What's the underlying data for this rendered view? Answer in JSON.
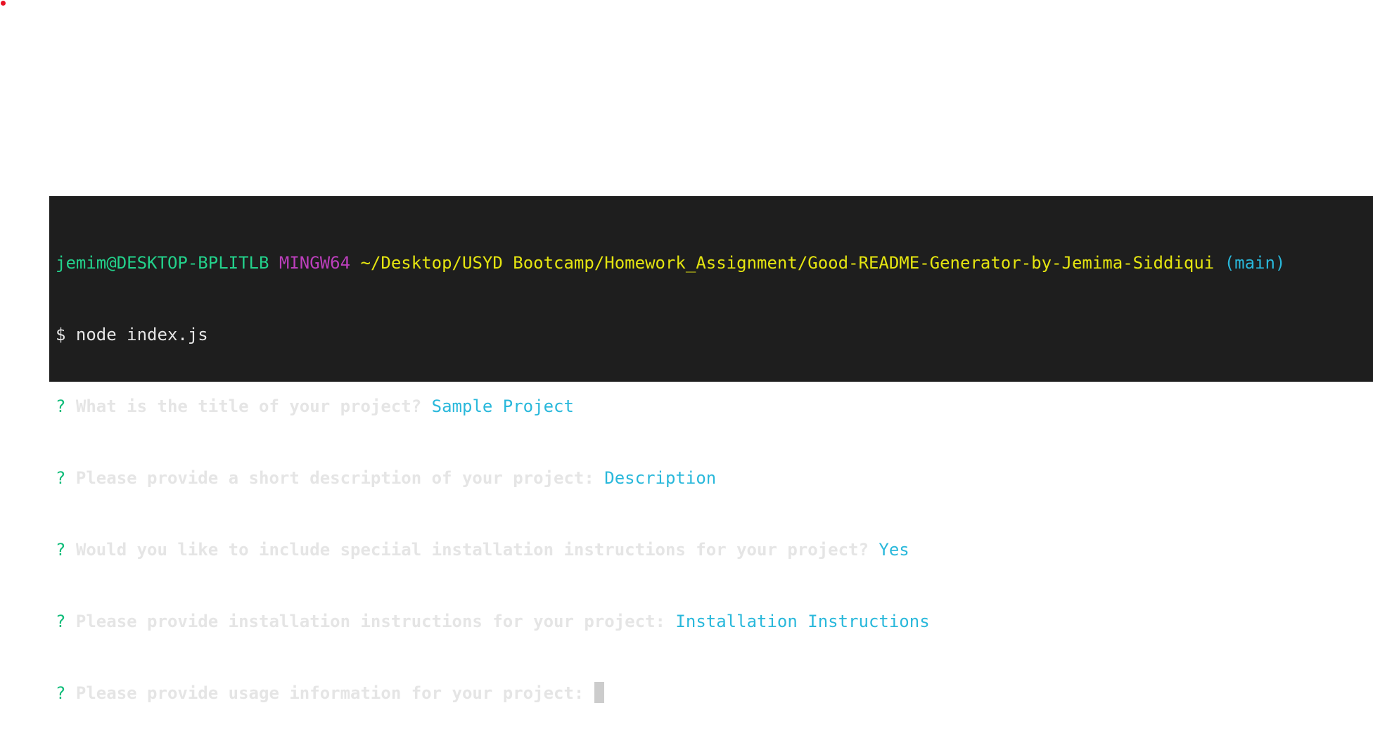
{
  "prompt": {
    "user_host": "jemim@DESKTOP-BPLITLB",
    "shell": "MINGW64",
    "path": "~/Desktop/USYD Bootcamp/Homework_Assignment/Good-README-Generator-by-Jemima-Siddiqui",
    "branch": "(main)"
  },
  "command": {
    "symbol": "$",
    "text": "node index.js"
  },
  "questions": [
    {
      "marker": "?",
      "question": "What is the title of your project?",
      "answer": "Sample Project"
    },
    {
      "marker": "?",
      "question": "Please provide a short description of your project:",
      "answer": "Description"
    },
    {
      "marker": "?",
      "question": "Would you like to include speciial installation instructions for your project?",
      "answer": "Yes"
    },
    {
      "marker": "?",
      "question": "Please provide installation instructions for your project:",
      "answer": "Installation Instructions"
    },
    {
      "marker": "?",
      "question": "Please provide usage information for your project:",
      "answer": ""
    }
  ],
  "colors": {
    "background": "#1e1e1e",
    "user_host": "#23d18b",
    "shell": "#bc3fbc",
    "path": "#e5e510",
    "branch": "#29b8db",
    "answer": "#29b8db"
  }
}
